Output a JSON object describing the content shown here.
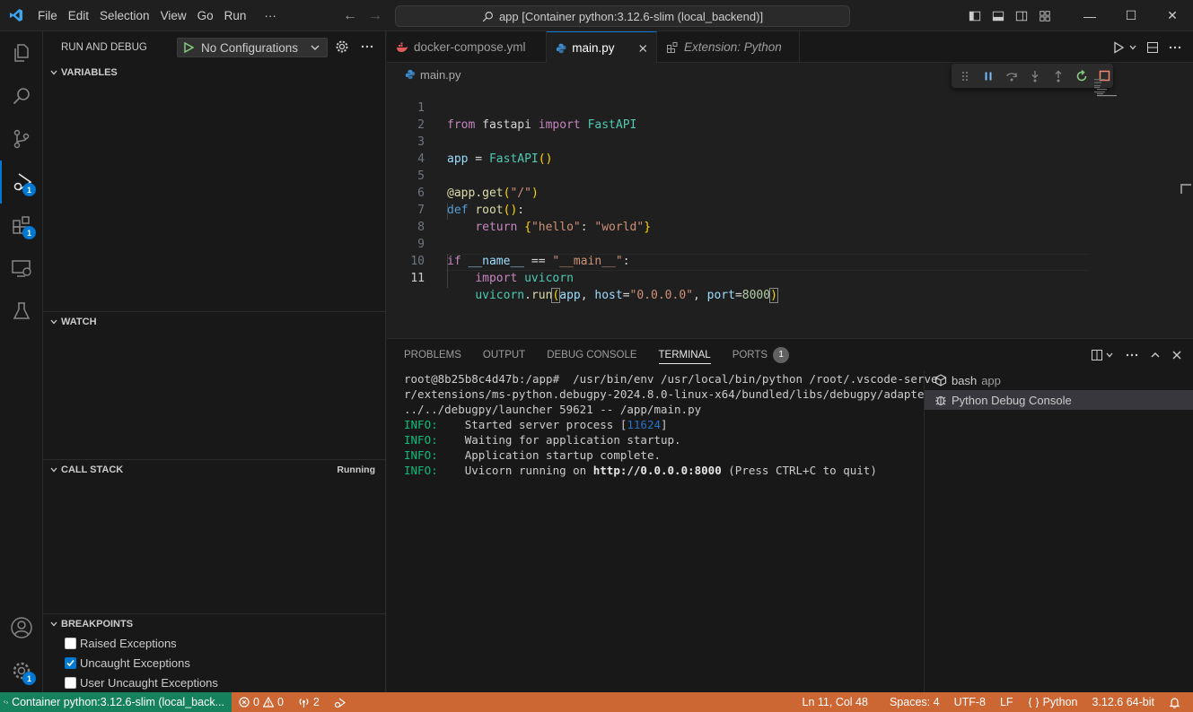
{
  "titlebar": {
    "menu": [
      "File",
      "Edit",
      "Selection",
      "View",
      "Go",
      "Run",
      "···"
    ],
    "search_text": "app [Container python:3.12.6-slim (local_backend)]"
  },
  "activity_bar": {
    "badges": {
      "run_debug": "1",
      "extensions": "1",
      "manage": "1"
    }
  },
  "sidebar": {
    "title": "RUN AND DEBUG",
    "config_select": "No Configurations",
    "sections": {
      "variables": "VARIABLES",
      "watch": "WATCH",
      "call_stack": "CALL STACK",
      "call_stack_status": "Running",
      "breakpoints": "BREAKPOINTS"
    },
    "breakpoints": [
      {
        "label": "Raised Exceptions",
        "checked": false
      },
      {
        "label": "Uncaught Exceptions",
        "checked": true
      },
      {
        "label": "User Uncaught Exceptions",
        "checked": false
      }
    ]
  },
  "editor": {
    "tabs": [
      {
        "label": "docker-compose.yml",
        "icon": "docker-icon"
      },
      {
        "label": "main.py",
        "icon": "python-icon",
        "active": true
      },
      {
        "label": "Extension: Python",
        "icon": "extensions-icon",
        "preview": true
      }
    ],
    "breadcrumb": "main.py",
    "line_numbers": [
      "1",
      "2",
      "3",
      "4",
      "5",
      "6",
      "7",
      "8",
      "9",
      "10",
      "11"
    ],
    "current_line": "11",
    "code_lines": [
      "from fastapi import FastAPI",
      "",
      "app = FastAPI()",
      "",
      "@app.get(\"/\")",
      "def root():",
      "    return {\"hello\": \"world\"}",
      "",
      "if __name__ == \"__main__\":",
      "    import uvicorn",
      "    uvicorn.run(app, host=\"0.0.0.0\", port=8000)"
    ]
  },
  "panel": {
    "tabs": [
      "PROBLEMS",
      "OUTPUT",
      "DEBUG CONSOLE",
      "TERMINAL",
      "PORTS"
    ],
    "active_tab": "TERMINAL",
    "ports_badge": "1",
    "terminal_lines": [
      "root@8b25b8c4d47b:/app#  /usr/bin/env /usr/local/bin/python /root/.vscode-serve",
      "r/extensions/ms-python.debugpy-2024.8.0-linux-x64/bundled/libs/debugpy/adapter/",
      "../../debugpy/launcher 59621 -- /app/main.py"
    ],
    "log": [
      {
        "level": "INFO:",
        "text": "Started server process [",
        "pid": "11624",
        "end": "]"
      },
      {
        "level": "INFO:",
        "text": "Waiting for application startup."
      },
      {
        "level": "INFO:",
        "text": "Application startup complete."
      },
      {
        "level": "INFO:",
        "text": "Uvicorn running on ",
        "url": "http://0.0.0.0:8000",
        "end": " (Press CTRL+C to quit)"
      }
    ],
    "terminals": [
      {
        "name": "bash",
        "detail": "app"
      },
      {
        "name": "Python Debug Console",
        "detail": "",
        "selected": true
      }
    ]
  },
  "statusbar": {
    "remote": "Container python:3.12.6-slim (local_back...",
    "errors": "0",
    "warnings": "0",
    "ports": "2",
    "position": "Ln 11, Col 48",
    "spaces": "Spaces: 4",
    "encoding": "UTF-8",
    "eol": "LF",
    "language": "Python",
    "interpreter": "3.12.6 64-bit"
  },
  "colors": {
    "accent": "#0078d4",
    "statusbar": "#cc6633",
    "remote": "#16825d"
  }
}
